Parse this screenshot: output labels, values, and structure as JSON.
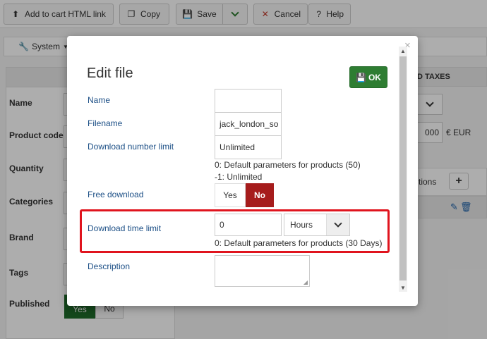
{
  "toolbar": {
    "add_to_cart": "Add to cart HTML link",
    "copy": "Copy",
    "save": "Save",
    "cancel": "Cancel",
    "help": "Help"
  },
  "subbar": {
    "system": "System"
  },
  "product_form": {
    "fields": [
      "Name",
      "Product code",
      "Quantity",
      "Categories",
      "Brand",
      "Tags",
      "Published"
    ],
    "published_yes": "Yes",
    "published_no": "No"
  },
  "price_panel": {
    "heading": "D TAXES",
    "price_value": "000",
    "currency": "€ EUR",
    "options_label": "tions"
  },
  "modal": {
    "title": "Edit file",
    "ok_label": "OK",
    "name_label": "Name",
    "name_value": "",
    "filename_label": "Filename",
    "filename_value": "jack_london_so",
    "download_limit_label": "Download number limit",
    "download_limit_value": "Unlimited",
    "download_limit_hint_1": "0: Default parameters for products (50)",
    "download_limit_hint_2": "-1: Unlimited",
    "free_download_label": "Free download",
    "free_yes": "Yes",
    "free_no": "No",
    "time_limit_label": "Download time limit",
    "time_limit_value": "0",
    "time_unit": "Hours",
    "time_limit_hint": "0: Default parameters for products (30 Days)",
    "description_label": "Description"
  },
  "colors": {
    "ok_green": "#2e7d32",
    "no_red": "#a61c1c",
    "highlight_red": "#e0141e",
    "label_blue": "#1c4f86"
  }
}
